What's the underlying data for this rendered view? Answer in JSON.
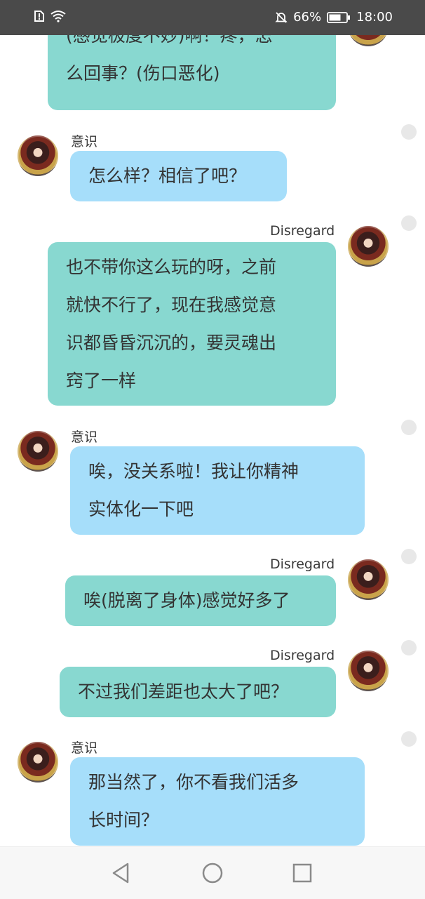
{
  "status_bar": {
    "battery_percent": "66%",
    "time": "18:00",
    "icons": [
      "sim-alert-icon",
      "wifi-icon",
      "mute-icon",
      "battery-icon"
    ]
  },
  "users": {
    "me": "Disregard",
    "them": "意识"
  },
  "messages": [
    {
      "sender": "me",
      "lines": [
        "(感觉极度不妙)啊！疼，怎",
        "么回事？(伤口恶化)"
      ]
    },
    {
      "sender": "them",
      "name": "意识",
      "lines": [
        "怎么样？相信了吧？"
      ]
    },
    {
      "sender": "me",
      "name": "Disregard",
      "lines": [
        "也不带你这么玩的呀，之前",
        "就快不行了，现在我感觉意",
        "识都昏昏沉沉的，要灵魂出",
        "窍了一样"
      ]
    },
    {
      "sender": "them",
      "name": "意识",
      "lines": [
        "唉，没关系啦！我让你精神",
        "实体化一下吧"
      ]
    },
    {
      "sender": "me",
      "name": "Disregard",
      "lines": [
        "唉(脱离了身体)感觉好多了"
      ]
    },
    {
      "sender": "me",
      "name": "Disregard",
      "lines": [
        "不过我们差距也太大了吧？"
      ]
    },
    {
      "sender": "them",
      "name": "意识",
      "lines": [
        "那当然了，你不看我们活多",
        "长时间？"
      ]
    }
  ],
  "nav": {
    "buttons": [
      "back-icon",
      "home-icon",
      "recents-icon"
    ]
  }
}
